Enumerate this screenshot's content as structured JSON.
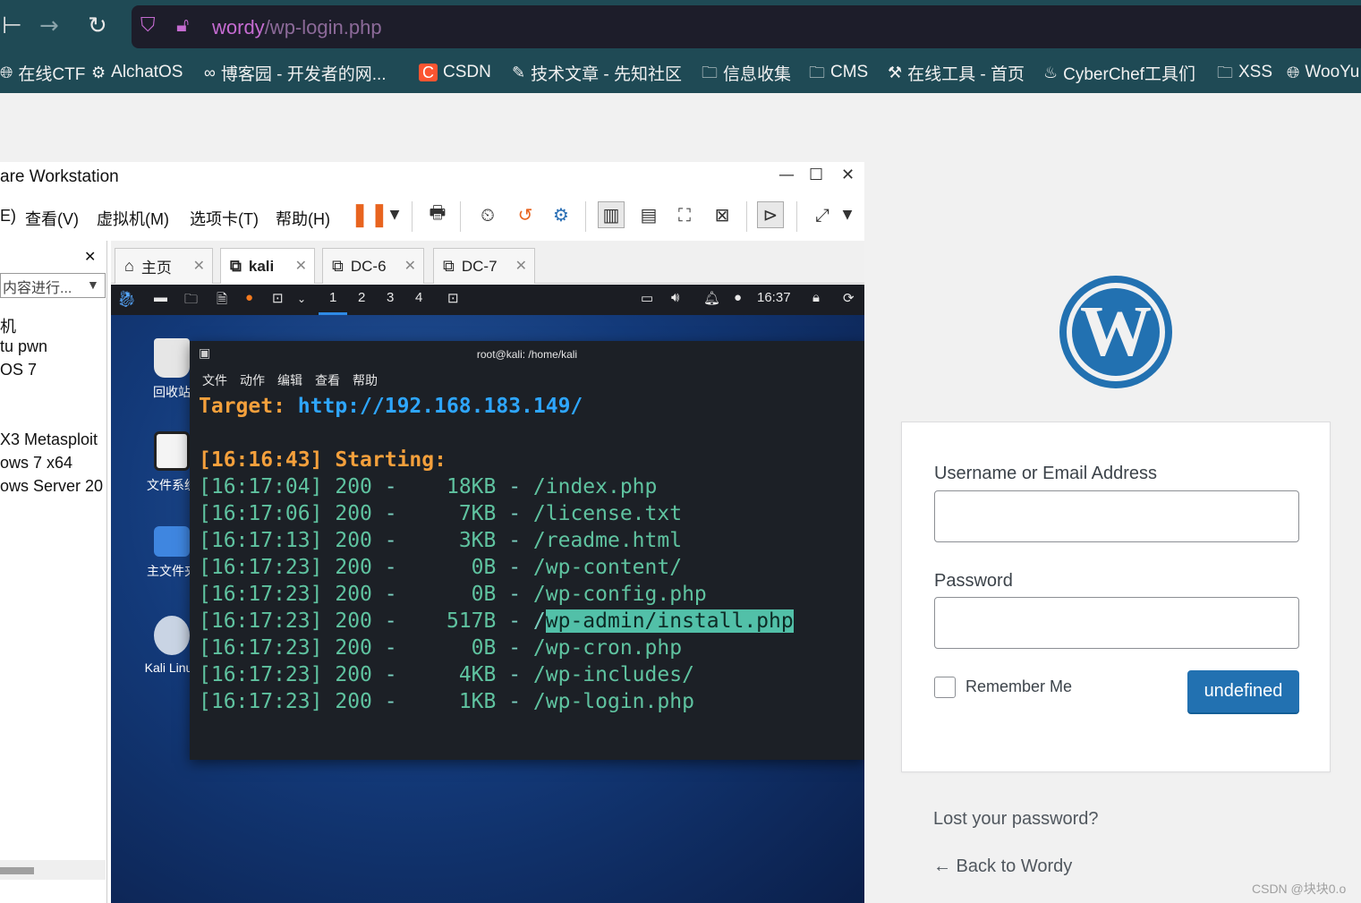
{
  "browser": {
    "url_host": "wordy",
    "url_path": "/wp-login.php",
    "bookmarks": [
      {
        "label": "在线CTF",
        "icon": "globe-icon"
      },
      {
        "label": "AlchatOS",
        "icon": "openai-icon"
      },
      {
        "label": "博客园 - 开发者的网...",
        "icon": "cnblogs-icon"
      },
      {
        "label": "CSDN",
        "icon": "csdn-icon"
      },
      {
        "label": "技术文章 - 先知社区",
        "icon": "xianzhi-icon"
      },
      {
        "label": "信息收集",
        "icon": "folder-icon"
      },
      {
        "label": "CMS",
        "icon": "folder-icon"
      },
      {
        "label": "在线工具 - 首页",
        "icon": "tool-icon"
      },
      {
        "label": "CyberChef工具们",
        "icon": "chef-icon"
      },
      {
        "label": "XSS",
        "icon": "folder-icon"
      },
      {
        "label": "WooYu",
        "icon": "globe-icon"
      }
    ]
  },
  "vmware": {
    "title": "are Workstation",
    "menu": [
      "E)",
      "查看(V)",
      "虚拟机(M)",
      "选项卡(T)",
      "帮助(H)"
    ],
    "library": {
      "search_placeholder": "内容进行...",
      "items": [
        "机",
        "tu pwn",
        "OS 7",
        "X3 Metasploit",
        "ows 7 x64",
        "ows Server 20"
      ]
    },
    "tabs": [
      {
        "label": "主页",
        "active": false
      },
      {
        "label": "kali",
        "active": true
      },
      {
        "label": "DC-6",
        "active": false
      },
      {
        "label": "DC-7",
        "active": false
      }
    ]
  },
  "kali": {
    "workspaces": [
      "1",
      "2",
      "3",
      "4"
    ],
    "clock": "16:37",
    "desktop_icons": [
      "回收站",
      "文件系统",
      "主文件夹",
      "Kali Linux"
    ],
    "terminal": {
      "title": "root@kali: /home/kali",
      "menu": [
        "文件",
        "动作",
        "编辑",
        "查看",
        "帮助"
      ],
      "target_label": "Target:",
      "target_url": "http://192.168.183.149/",
      "start_time": "[16:16:43]",
      "start_label": "Starting:",
      "results": [
        {
          "time": "[16:17:04]",
          "status": "200",
          "size": "18KB",
          "path": "/index.php"
        },
        {
          "time": "[16:17:06]",
          "status": "200",
          "size": "7KB",
          "path": "/license.txt"
        },
        {
          "time": "[16:17:13]",
          "status": "200",
          "size": "3KB",
          "path": "/readme.html"
        },
        {
          "time": "[16:17:23]",
          "status": "200",
          "size": "0B",
          "path": "/wp-content/"
        },
        {
          "time": "[16:17:23]",
          "status": "200",
          "size": "0B",
          "path": "/wp-config.php"
        },
        {
          "time": "[16:17:23]",
          "status": "200",
          "size": "517B",
          "path": "/wp-admin/install.php"
        },
        {
          "time": "[16:17:23]",
          "status": "200",
          "size": "0B",
          "path": "/wp-cron.php"
        },
        {
          "time": "[16:17:23]",
          "status": "200",
          "size": "4KB",
          "path": "/wp-includes/"
        },
        {
          "time": "[16:17:23]",
          "status": "200",
          "size": "1KB",
          "path": "/wp-login.php"
        }
      ]
    }
  },
  "wp_login": {
    "username_label": "Username or Email Address",
    "password_label": "Password",
    "remember_label": "Remember Me",
    "submit_label": "undefined",
    "lost_password": "Lost your password?",
    "back_link": "← Back to Wordy",
    "accent": "#2271b1"
  },
  "watermark": "CSDN @块块0.o"
}
